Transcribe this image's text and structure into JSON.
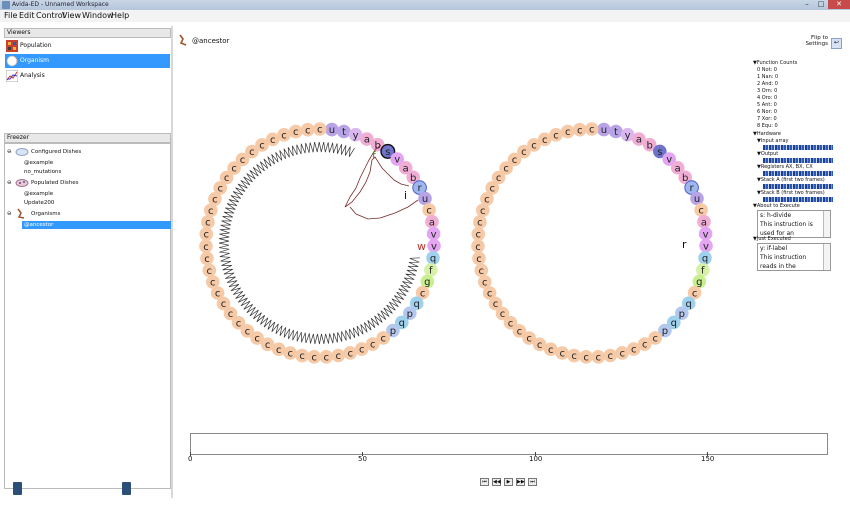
{
  "window": {
    "title": "Avida-ED - Unnamed Workspace"
  },
  "menu": {
    "items": [
      "File",
      "Edit",
      "Control",
      "View",
      "Window",
      "Help"
    ]
  },
  "viewers": {
    "header": "Viewers",
    "items": [
      {
        "label": "Population",
        "icon": "population-grid-icon"
      },
      {
        "label": "Organism",
        "icon": "organism-icon",
        "selected": true
      },
      {
        "label": "Analysis",
        "icon": "analysis-chart-icon"
      }
    ]
  },
  "freezer": {
    "header": "Freezer",
    "rows": [
      {
        "label": "Configured Dishes",
        "indent": 1,
        "icon": "petri-dish-icon"
      },
      {
        "label": "@example",
        "indent": 2
      },
      {
        "label": "no_mutations",
        "indent": 2
      },
      {
        "label": "Populated Dishes",
        "indent": 1,
        "icon": "populated-dish-icon"
      },
      {
        "label": "@example",
        "indent": 2
      },
      {
        "label": "Update200",
        "indent": 2
      },
      {
        "label": "Organisms",
        "indent": 1,
        "icon": "organism-icon"
      },
      {
        "label": "@ancestor",
        "indent": 2,
        "selected": true
      }
    ]
  },
  "organism": {
    "name": "@ancestor"
  },
  "flip": {
    "label1": "Flip to",
    "label2": "Settings"
  },
  "genome_left": "utyabsvabrucavvqfgcqpqpcccccccccccccccccccccccccccccccccccc",
  "genome_right": "utyabsvabrucavvqfgcqpqpcccccccccccccccccccccccccccccccccccc",
  "annotations": {
    "f": "f",
    "i": "i",
    "w": "w",
    "r": "r"
  },
  "colors": {
    "c": "#f6c9a7",
    "u": "#b7a3e6",
    "t": "#b7a3e6",
    "y": "#dab7ee",
    "a": "#f1aed5",
    "b": "#f1aed5",
    "s": "#6f73c9",
    "v": "#e4a6f2",
    "r": "#9fb7ee",
    "q": "#9fd0ee",
    "f": "#d7f0a8",
    "g": "#c8ef8e",
    "p": "#b4c8ee",
    "annotation_f": "#3a8a2a",
    "annotation_w": "#b6342b",
    "annotation_i": "#111111"
  },
  "timeline": {
    "ticks": [
      "0",
      "50",
      "100",
      "150"
    ],
    "max": 185
  },
  "player": {
    "buttons": [
      "⏮",
      "◀◀",
      "▶",
      "▶▶",
      "⏭"
    ]
  },
  "side": {
    "function_counts_title": "Function Counts",
    "counts": [
      "0 Not: 0",
      "1 Nan: 0",
      "2 And: 0",
      "3 Orn: 0",
      "4 Oro: 0",
      "5 Ant: 0",
      "6 Nor: 0",
      "7 Xor: 0",
      "8 Equ: 0"
    ],
    "hardware_title": "Hardware",
    "hw": [
      "Input array",
      "Output",
      "Registers AX, BX, CX",
      "Stack A (first two frames)",
      "Stack B (first two frames)"
    ],
    "about_title": "About to Execute",
    "about_text": "s: h-divide",
    "about_text2": "This instruction is",
    "about_text3": "used for an",
    "just_title": "Just Executed",
    "just_text": "y: if-label",
    "just_text2": "This instruction",
    "just_text3": "reads in the"
  }
}
